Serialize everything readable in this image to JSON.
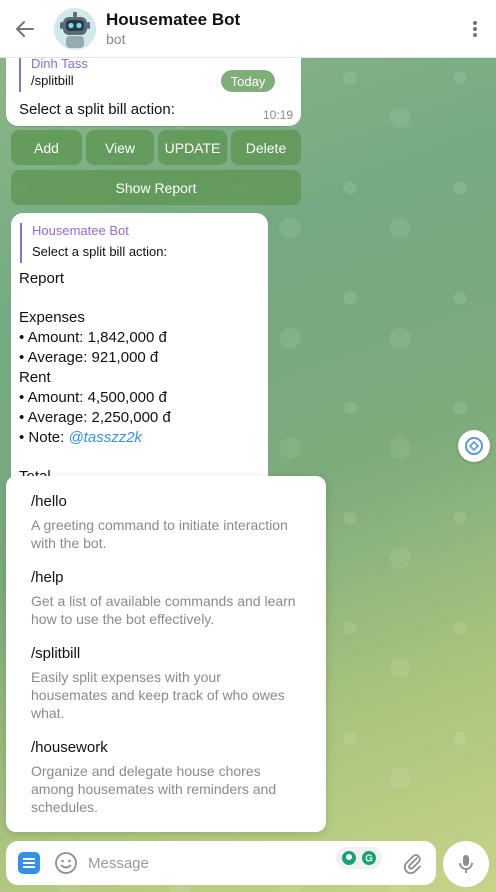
{
  "header": {
    "title": "Housematee Bot",
    "subtitle": "bot"
  },
  "date_pill": "Today",
  "msg1": {
    "reply_name": "Dinh Tass",
    "reply_text": "/splitbill",
    "text": "Select a split bill action:",
    "time": "10:19"
  },
  "keyboard": {
    "add": "Add",
    "view": "View",
    "update": "UPDATE",
    "delete": "Delete",
    "show_report": "Show Report"
  },
  "msg2": {
    "reply_name": "Housematee Bot",
    "reply_text": "Select a split bill action:",
    "report_title": "Report",
    "expenses_label": "Expenses",
    "expenses_amount_label": "• Amount:",
    "expenses_amount": "1,842,000 đ",
    "expenses_avg_label": "• Average:",
    "expenses_avg": "921,000 đ",
    "rent_label": "Rent",
    "rent_amount_label": "• Amount:",
    "rent_amount": "4,500,000 đ",
    "rent_avg_label": "• Average:",
    "rent_avg": "2,250,000 đ",
    "note_label": "• Note:",
    "note_value": "@tasszz2k",
    "total_label": "Total"
  },
  "commands": [
    {
      "name": "/hello",
      "desc": "A greeting command to initiate interaction with the bot."
    },
    {
      "name": "/help",
      "desc": "Get a list of available commands and learn how to use the bot effectively."
    },
    {
      "name": "/splitbill",
      "desc": "Easily split expenses with your housemates and keep track of who owes what."
    },
    {
      "name": "/housework",
      "desc": "Organize and delegate house chores among housemates with reminders and schedules."
    }
  ],
  "input": {
    "placeholder": "Message"
  },
  "colors": {
    "accent": "#3390ec",
    "reply_bar": "#8b6fd6",
    "button_bg": "#5c9652"
  }
}
